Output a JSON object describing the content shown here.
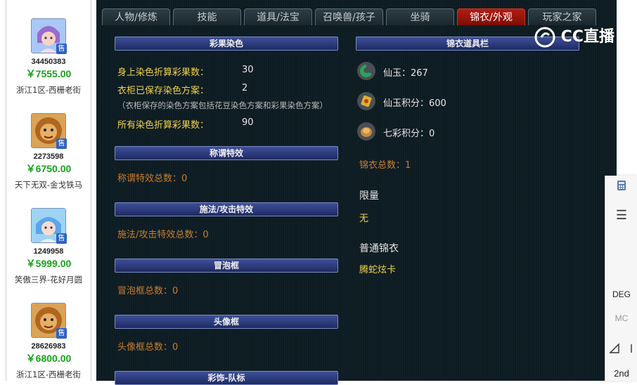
{
  "listings": [
    {
      "id": "34450383",
      "price": "￥7555.00",
      "server": "浙江1区-西栅老街",
      "tag": "售"
    },
    {
      "id": "2273598",
      "price": "￥6750.00",
      "server": "天下无双-金戈铁马",
      "tag": "售"
    },
    {
      "id": "1249958",
      "price": "￥5999.00",
      "server": "笑傲三界-花好月圆",
      "tag": "售"
    },
    {
      "id": "28626983",
      "price": "￥6800.00",
      "server": "浙江1区-西栅老街",
      "tag": "售"
    }
  ],
  "tabs": [
    "人物/修炼",
    "技能",
    "道具/法宝",
    "召唤兽/孩子",
    "坐骑",
    "锦衣/外观",
    "玩家之家"
  ],
  "active_tab": "锦衣/外观",
  "left_panel": {
    "dye": {
      "header": "彩果染色",
      "body_label": "身上染色折算彩果数：",
      "body_value": "30",
      "wardrobe_label": "衣柜已保存染色方案：",
      "wardrobe_value": "2",
      "note": "（衣柜保存的染色方案包括花豆染色方案和彩果染色方案）",
      "total_label": "所有染色折算彩果数：",
      "total_value": "90"
    },
    "title_fx": {
      "header": "称谓特效",
      "text": "称谓特效总数：0"
    },
    "cast_fx": {
      "header": "施法/攻击特效",
      "text": "施法/攻击特效总数：0"
    },
    "bubble": {
      "header": "冒泡框",
      "text": "冒泡框总数：0"
    },
    "avatar_frame": {
      "header": "头像框",
      "text": "头像框总数：0"
    },
    "team_badge": {
      "header": "彩饰-队标"
    }
  },
  "right_panel": {
    "header": "锦衣道具栏",
    "items": [
      {
        "icon": "jade-icon",
        "text": "仙玉：267",
        "color": "#2aa35a"
      },
      {
        "icon": "scroll-icon",
        "text": "仙玉积分：600",
        "color": "#e0b030"
      },
      {
        "icon": "coin-icon",
        "text": "七彩积分：0",
        "color": "#c88a3a"
      }
    ],
    "total": "锦衣总数：1",
    "limited_label": "限量",
    "limited_value": "无",
    "normal_label": "普通锦衣",
    "normal_value": "腾蛇炫卡"
  },
  "watermark": "CC直播",
  "side_tools": {
    "deg": "DEG",
    "mc": "MC",
    "second": "2nd"
  }
}
